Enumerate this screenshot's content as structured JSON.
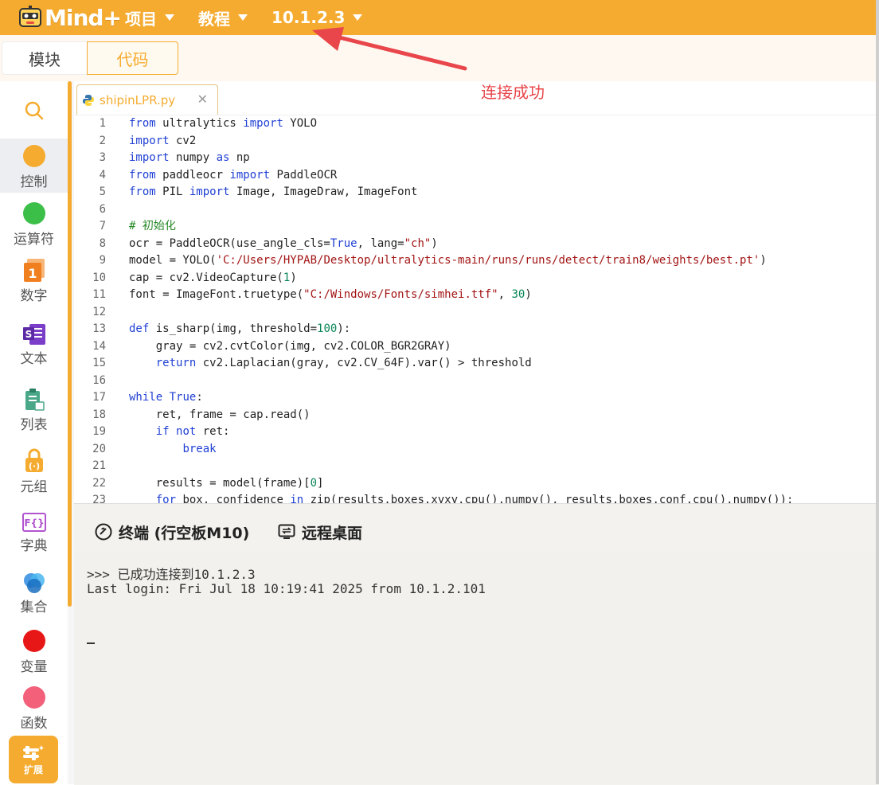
{
  "topbar": {
    "logo_text": "Mind+",
    "menus": [
      {
        "label": "项目"
      },
      {
        "label": "教程"
      },
      {
        "label": "10.1.2.3"
      }
    ]
  },
  "mode_tabs": {
    "blocks": "模块",
    "code": "代码"
  },
  "annotation": {
    "text": "连接成功",
    "color": "#e8464a"
  },
  "sidebar": {
    "categories": [
      {
        "label": "控制",
        "icon": "circle",
        "color": "#f5ab2f"
      },
      {
        "label": "运算符",
        "icon": "circle",
        "color": "#3cbf49"
      },
      {
        "label": "数字",
        "icon": "number-1-icon",
        "color": "#f07f1f"
      },
      {
        "label": "文本",
        "icon": "text-s-icon",
        "color": "#7b3ec9"
      },
      {
        "label": "列表",
        "icon": "list-clipboard-icon",
        "color": "#4aa889"
      },
      {
        "label": "元组",
        "icon": "lock-parens-icon",
        "color": "#f5ab2f"
      },
      {
        "label": "字典",
        "icon": "dict-braces-icon",
        "color": "#b154d0"
      },
      {
        "label": "集合",
        "icon": "venn-circles-icon",
        "color": "#2e8be0"
      },
      {
        "label": "变量",
        "icon": "circle",
        "color": "#e81717"
      },
      {
        "label": "函数",
        "icon": "circle",
        "color": "#f2607a"
      }
    ],
    "extension_label": "扩展"
  },
  "editor": {
    "file_name": "shipinLPR.py",
    "lines": [
      {
        "n": "1",
        "tokens": [
          [
            "kw",
            "from"
          ],
          [
            "t",
            " ultralytics "
          ],
          [
            "kw",
            "import"
          ],
          [
            "t",
            " YOLO"
          ]
        ]
      },
      {
        "n": "2",
        "tokens": [
          [
            "kw",
            "import"
          ],
          [
            "t",
            " cv2"
          ]
        ]
      },
      {
        "n": "3",
        "tokens": [
          [
            "kw",
            "import"
          ],
          [
            "t",
            " numpy "
          ],
          [
            "kw",
            "as"
          ],
          [
            "t",
            " np"
          ]
        ]
      },
      {
        "n": "4",
        "tokens": [
          [
            "kw",
            "from"
          ],
          [
            "t",
            " paddleocr "
          ],
          [
            "kw",
            "import"
          ],
          [
            "t",
            " PaddleOCR"
          ]
        ]
      },
      {
        "n": "5",
        "tokens": [
          [
            "kw",
            "from"
          ],
          [
            "t",
            " PIL "
          ],
          [
            "kw",
            "import"
          ],
          [
            "t",
            " Image, ImageDraw, ImageFont"
          ]
        ]
      },
      {
        "n": "6",
        "tokens": []
      },
      {
        "n": "7",
        "tokens": [
          [
            "cm",
            "# 初始化"
          ]
        ]
      },
      {
        "n": "8",
        "tokens": [
          [
            "t",
            "ocr = PaddleOCR(use_angle_cls="
          ],
          [
            "kw",
            "True"
          ],
          [
            "t",
            ", lang="
          ],
          [
            "str",
            "\"ch\""
          ],
          [
            "t",
            ")"
          ]
        ]
      },
      {
        "n": "9",
        "tokens": [
          [
            "t",
            "model = YOLO("
          ],
          [
            "str",
            "'C:/Users/HYPAB/Desktop/ultralytics-main/runs/runs/detect/train8/weights/best.pt'"
          ],
          [
            "t",
            ")"
          ]
        ]
      },
      {
        "n": "10",
        "tokens": [
          [
            "t",
            "cap = cv2.VideoCapture("
          ],
          [
            "num",
            "1"
          ],
          [
            "t",
            ")"
          ]
        ]
      },
      {
        "n": "11",
        "tokens": [
          [
            "t",
            "font = ImageFont.truetype("
          ],
          [
            "str",
            "\"C:/Windows/Fonts/simhei.ttf\""
          ],
          [
            "t",
            ", "
          ],
          [
            "num",
            "30"
          ],
          [
            "t",
            ")"
          ]
        ]
      },
      {
        "n": "12",
        "tokens": []
      },
      {
        "n": "13",
        "tokens": [
          [
            "kw",
            "def"
          ],
          [
            "t",
            " is_sharp(img, threshold="
          ],
          [
            "num",
            "100"
          ],
          [
            "t",
            "):"
          ]
        ]
      },
      {
        "n": "14",
        "tokens": [
          [
            "t",
            "    gray = cv2.cvtColor(img, cv2.COLOR_BGR2GRAY)"
          ]
        ]
      },
      {
        "n": "15",
        "tokens": [
          [
            "t",
            "    "
          ],
          [
            "kw",
            "return"
          ],
          [
            "t",
            " cv2.Laplacian(gray, cv2.CV_64F).var() > threshold"
          ]
        ]
      },
      {
        "n": "16",
        "tokens": []
      },
      {
        "n": "17",
        "tokens": [
          [
            "kw",
            "while"
          ],
          [
            "t",
            " "
          ],
          [
            "kw",
            "True"
          ],
          [
            "t",
            ":"
          ]
        ]
      },
      {
        "n": "18",
        "tokens": [
          [
            "t",
            "    ret, frame = cap.read()"
          ]
        ]
      },
      {
        "n": "19",
        "tokens": [
          [
            "t",
            "    "
          ],
          [
            "kw",
            "if"
          ],
          [
            "t",
            " "
          ],
          [
            "kw",
            "not"
          ],
          [
            "t",
            " ret:"
          ]
        ]
      },
      {
        "n": "20",
        "tokens": [
          [
            "t",
            "        "
          ],
          [
            "kw",
            "break"
          ]
        ]
      },
      {
        "n": "21",
        "tokens": []
      },
      {
        "n": "22",
        "tokens": [
          [
            "t",
            "    results = model(frame)["
          ],
          [
            "num",
            "0"
          ],
          [
            "t",
            "]"
          ]
        ]
      },
      {
        "n": "23",
        "tokens": [
          [
            "t",
            "    "
          ],
          [
            "kw",
            "for"
          ],
          [
            "t",
            " box, confidence "
          ],
          [
            "kw",
            "in"
          ],
          [
            "t",
            " zip(results.boxes.xyxy.cpu().numpy(), results.boxes.conf.cpu().numpy()):"
          ]
        ]
      }
    ]
  },
  "terminal": {
    "tabs": [
      {
        "label": "终端 (行空板M10)",
        "icon": "terminal-link-icon"
      },
      {
        "label": "远程桌面",
        "icon": "remote-desktop-icon"
      }
    ],
    "lines": [
      ">>> 已成功连接到10.1.2.3",
      "Last login: Fri Jul 18 10:19:41 2025 from 10.1.2.101"
    ]
  }
}
